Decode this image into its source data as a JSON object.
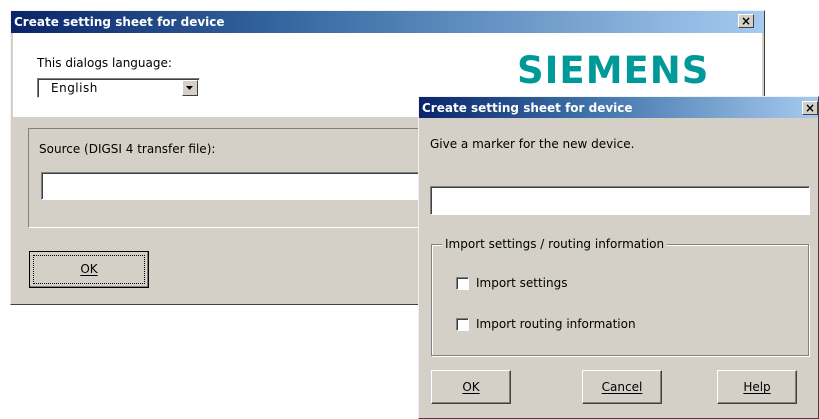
{
  "back_dialog": {
    "title": "Create setting sheet for device",
    "close_glyph": "×",
    "language_label": "This dialogs language:",
    "language_value": "English",
    "brand_logo": "SIEMENS",
    "brand_color": "#009999",
    "source_label": "Source (DIGSI 4 transfer file):",
    "source_value": "",
    "ok_label": "OK"
  },
  "front_dialog": {
    "title": "Create setting sheet for device",
    "close_glyph": "×",
    "marker_prompt": "Give a marker for the new device.",
    "marker_value": "",
    "group_title": "Import settings / routing information",
    "import_settings_label": "Import settings",
    "import_settings_checked": false,
    "import_routing_label": "Import routing information",
    "import_routing_checked": false,
    "ok_label": "OK",
    "cancel_label": "Cancel",
    "help_label": "Help"
  }
}
